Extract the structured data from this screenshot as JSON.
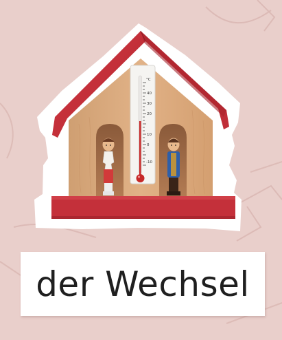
{
  "card": {
    "word": "der Wechsel"
  },
  "thermometer": {
    "unit": "°C",
    "ticks": [
      "40",
      "30",
      "20",
      "10",
      "0",
      "-10"
    ]
  },
  "colors": {
    "background": "#e9cfcb",
    "roof": "#c4303a",
    "wood": "#d9a878",
    "card": "#ffffff"
  }
}
